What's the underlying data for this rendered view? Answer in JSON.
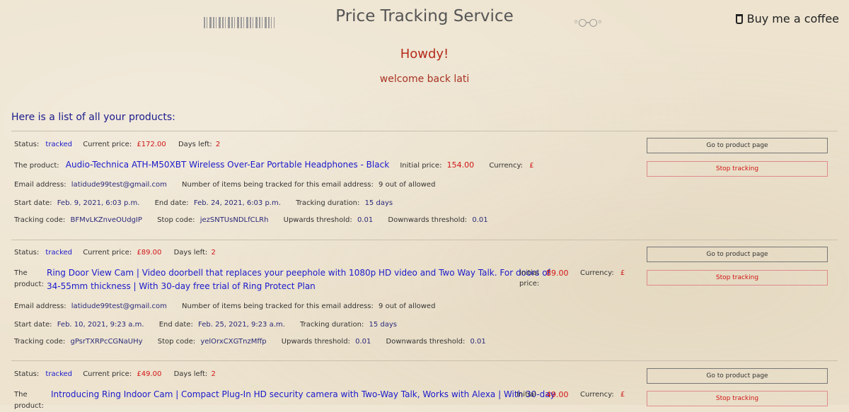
{
  "header": {
    "site_title": "Price Tracking Service",
    "coffee_label": "Buy me a coffee",
    "glasses_glyph": "◦○-○◦"
  },
  "greeting": {
    "howdy": "Howdy!",
    "welcome": "welcome back lati"
  },
  "list_heading": "Here is a list of all your products:",
  "labels": {
    "status": "Status:",
    "current_price": "Current price:",
    "days_left": "Days left:",
    "the_product": "The product:",
    "the": "The",
    "product": "product:",
    "initial_price": "Initial price:",
    "initial": "Initial",
    "price": "price:",
    "currency": "Currency:",
    "email": "Email address:",
    "items_tracked": "Number of items being tracked for this email address:",
    "start_date": "Start date:",
    "end_date": "End date:",
    "tracking_duration": "Tracking duration:",
    "tracking_code": "Tracking code:",
    "stop_code": "Stop code:",
    "upwards": "Upwards threshold:",
    "downwards": "Downwards threshold:",
    "go_button": "Go to product page",
    "stop_button": "Stop tracking"
  },
  "products": [
    {
      "status": "tracked",
      "current_price": "£172.00",
      "days_left": "2",
      "title": "Audio-Technica ATH-M50XBT Wireless Over-Ear Portable Headphones - Black",
      "initial_price": "154.00",
      "currency": "£",
      "email": "latidude99test@gmail.com",
      "items": "9 out of allowed",
      "start": "Feb. 9, 2021, 6:03 p.m.",
      "end": "Feb. 24, 2021, 6:03 p.m.",
      "duration": "15 days",
      "tracking_code": "BFMvLKZnveOUdgIP",
      "stop_code": "jezSNTUsNDLfCLRh",
      "upwards": "0.01",
      "downwards": "0.01"
    },
    {
      "status": "tracked",
      "current_price": "£89.00",
      "days_left": "2",
      "title_line1": "Ring Door View Cam | Video doorbell that replaces your peephole with 1080p HD video and Two Way Talk. For doors of",
      "title_line2": "34-55mm thickness | With 30-day free trial of Ring Protect Plan",
      "initial_price": "89.00",
      "currency": "£",
      "email": "latidude99test@gmail.com",
      "items": "9 out of allowed",
      "start": "Feb. 10, 2021, 9:23 a.m.",
      "end": "Feb. 25, 2021, 9:23 a.m.",
      "duration": "15 days",
      "tracking_code": "gPsrTXRPcCGNaUHy",
      "stop_code": "yelOrxCXGTnzMffp",
      "upwards": "0.01",
      "downwards": "0.01"
    },
    {
      "status": "tracked",
      "current_price": "£49.00",
      "days_left": "2",
      "title_line1": "Introducing Ring Indoor Cam | Compact Plug-In HD security camera with Two-Way Talk, Works with Alexa | With 30-day",
      "initial_price": "49.00",
      "currency": "£"
    }
  ]
}
